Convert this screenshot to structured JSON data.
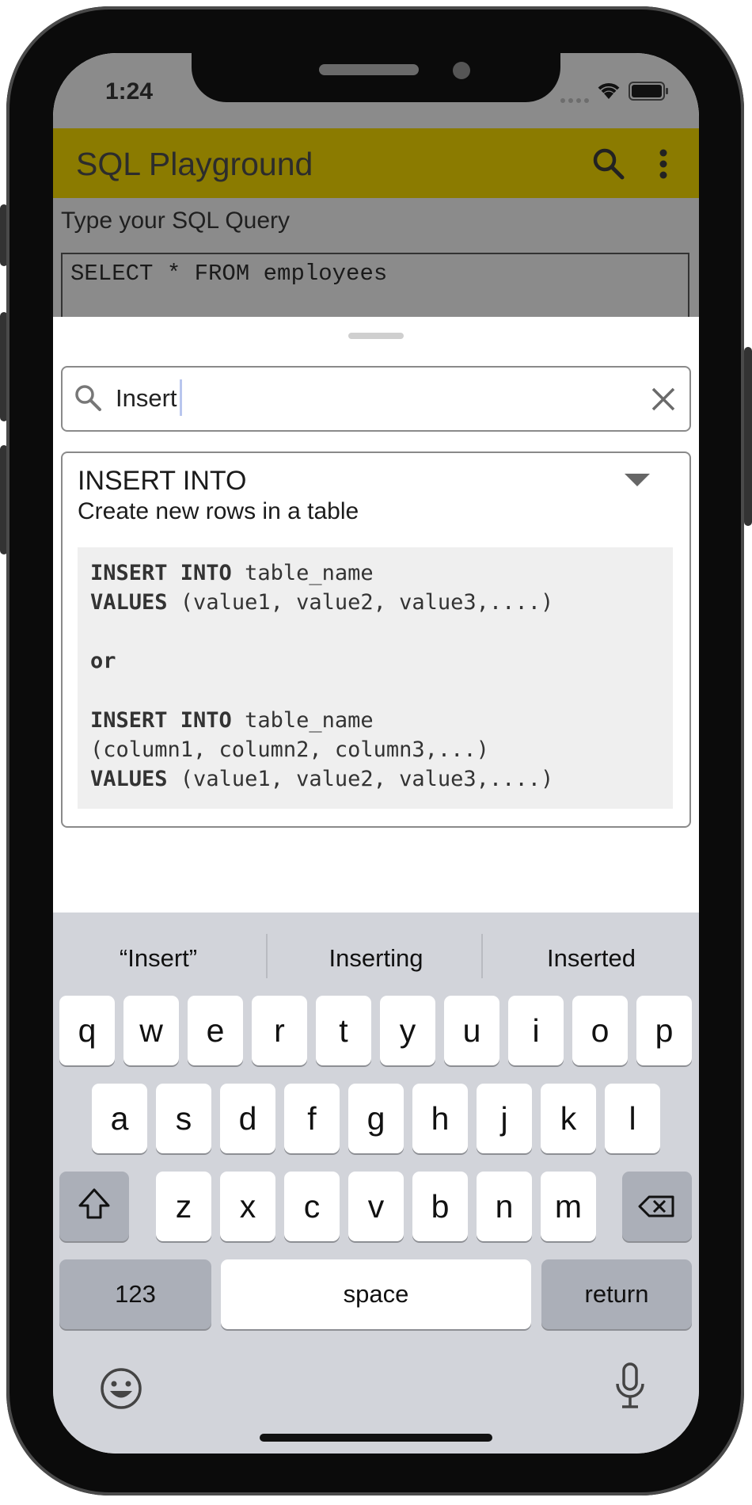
{
  "status_bar": {
    "time": "1:24"
  },
  "app_bar": {
    "title": "SQL Playground",
    "search_icon": "search-icon",
    "menu_icon": "more-vert-icon"
  },
  "editor": {
    "prompt": "Type your SQL Query",
    "query": "SELECT * FROM employees"
  },
  "sheet": {
    "search": {
      "value": "Insert",
      "icon": "search-icon",
      "clear_icon": "close-icon"
    },
    "card": {
      "title": "INSERT INTO",
      "subtitle": "Create new rows in a table",
      "expand_icon": "triangle-down-icon",
      "code": {
        "l1_kw": "INSERT INTO",
        "l1_rest": " table_name",
        "l2_kw": "VALUES",
        "l2_rest": " (value1, value2, value3,....)",
        "or": "or",
        "l4_kw": "INSERT INTO",
        "l4_rest": " table_name",
        "l5": "(column1, column2, column3,...)",
        "l6_kw": "VALUES",
        "l6_rest": " (value1, value2, value3,....)"
      }
    }
  },
  "keyboard": {
    "suggestions": [
      "“Insert”",
      "Inserting",
      "Inserted"
    ],
    "row1": [
      "q",
      "w",
      "e",
      "r",
      "t",
      "y",
      "u",
      "i",
      "o",
      "p"
    ],
    "row2": [
      "a",
      "s",
      "d",
      "f",
      "g",
      "h",
      "j",
      "k",
      "l"
    ],
    "row3": [
      "z",
      "x",
      "c",
      "v",
      "b",
      "n",
      "m"
    ],
    "numbers_label": "123",
    "space_label": "space",
    "return_label": "return",
    "shift_icon": "shift-icon",
    "delete_icon": "backspace-icon",
    "emoji_icon": "emoji-icon",
    "mic_icon": "microphone-icon"
  }
}
